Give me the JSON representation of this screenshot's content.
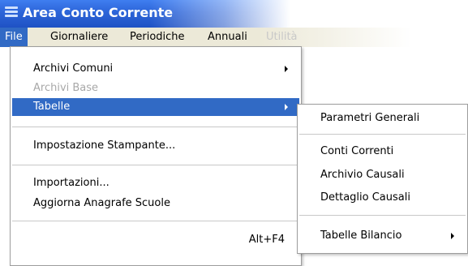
{
  "window": {
    "title": "Area Conto Corrente",
    "icon": "app-menu-icon"
  },
  "menubar": {
    "items": [
      {
        "label": "File",
        "state": "active"
      },
      {
        "label": "Giornaliere",
        "state": "normal"
      },
      {
        "label": "Periodiche",
        "state": "normal"
      },
      {
        "label": "Annuali",
        "state": "normal"
      },
      {
        "label": "Utilità",
        "state": "faded"
      }
    ]
  },
  "file_menu": {
    "items": [
      {
        "label": "Archivi Comuni",
        "has_submenu": true,
        "enabled": true
      },
      {
        "label": "Archivi Base",
        "has_submenu": false,
        "enabled": false
      },
      {
        "label": "Tabelle",
        "has_submenu": true,
        "enabled": true,
        "highlighted": true
      },
      {
        "label": "Impostazione Stampante...",
        "enabled": true
      },
      {
        "label": "Importazioni...",
        "enabled": true
      },
      {
        "label": "Aggiorna Anagrafe Scuole",
        "enabled": true
      },
      {
        "label": "",
        "shortcut": "Alt+F4",
        "enabled": true
      }
    ]
  },
  "tabelle_submenu": {
    "items": [
      {
        "label": "Parametri Generali",
        "enabled": true
      },
      {
        "label": "Conti Correnti",
        "enabled": true
      },
      {
        "label": "Archivio Causali",
        "enabled": true
      },
      {
        "label": "Dettaglio Causali",
        "enabled": true
      },
      {
        "label": "Tabelle Bilancio",
        "has_submenu": true,
        "enabled": true
      }
    ]
  },
  "colors": {
    "highlight": "#316ac5",
    "titlebar": "#2c64d8",
    "menubar": "#ece9d8"
  }
}
